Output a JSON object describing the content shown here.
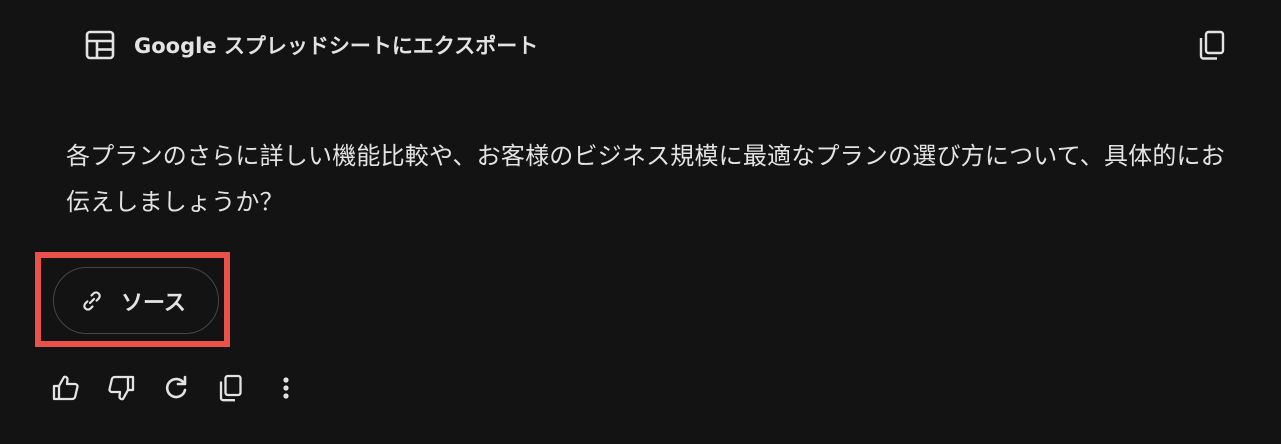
{
  "export": {
    "label": "Google スプレッドシートにエクスポート",
    "icon": "table-icon",
    "copy_icon": "copy-icon"
  },
  "message": {
    "text": "各プランのさらに詳しい機能比較や、お客様のビジネス規模に最適なプランの選び方について、具体的にお伝えしましょうか？"
  },
  "sources": {
    "label": "ソース",
    "icon": "link-icon",
    "highlight_color": "#e8524a"
  },
  "actions": {
    "icons": [
      "thumb-up-icon",
      "thumb-down-icon",
      "refresh-icon",
      "copy-icon",
      "more-vert-icon"
    ]
  },
  "colors": {
    "background": "#131314",
    "text": "#e3e3e3",
    "chip_border": "#444746"
  }
}
